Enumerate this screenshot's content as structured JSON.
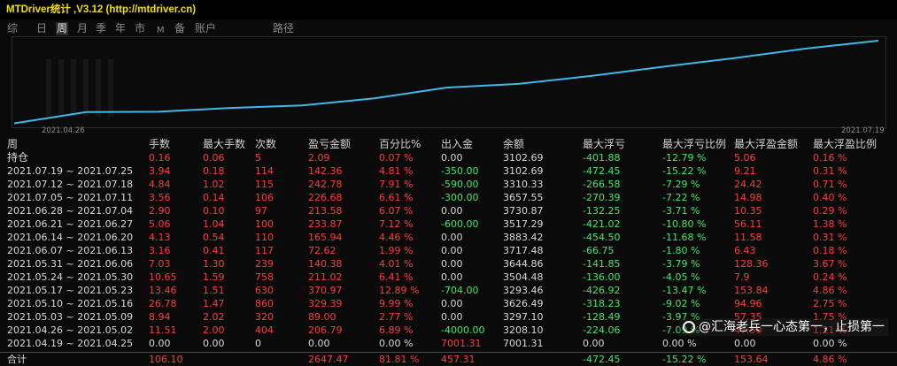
{
  "app": {
    "title": "MTDriver统计 ,V3.12 (http://mtdriver.cn)"
  },
  "tabs": [
    {
      "label": "综",
      "active": false
    },
    {
      "label": "日",
      "active": false
    },
    {
      "label": "周",
      "active": true
    },
    {
      "label": "月",
      "active": false
    },
    {
      "label": "季",
      "active": false
    },
    {
      "label": "年",
      "active": false
    },
    {
      "label": "市",
      "active": false
    },
    {
      "label": "M",
      "active": false
    },
    {
      "label": "备",
      "active": false
    },
    {
      "label": "账户",
      "active": false
    },
    {
      "label": "路径",
      "active": false
    }
  ],
  "chart_data": {
    "type": "line",
    "x": [
      "2021.04.26",
      "2021.05.03",
      "2021.05.10",
      "2021.05.17",
      "2021.05.24",
      "2021.05.31",
      "2021.06.07",
      "2021.06.14",
      "2021.06.21",
      "2021.06.28",
      "2021.07.05",
      "2021.07.12",
      "2021.07.19"
    ],
    "series": [
      {
        "values": [
          10,
          280,
          290,
          380,
          440,
          610,
          870,
          960,
          1150,
          1370,
          1580,
          1810,
          2000
        ]
      }
    ],
    "xlabel_start": "2021.04.26",
    "xlabel_end": "2021.07.19",
    "color": "#3fb8ea"
  },
  "table": {
    "headers": [
      "周",
      "手数",
      "最大手数",
      "次数",
      "盈亏金额",
      "百分比%",
      "出入金",
      "余额",
      "最大浮亏",
      "最大浮亏比例",
      "最大浮盈金额",
      "最大浮盈比例"
    ],
    "rows": [
      [
        "持仓",
        "0.16",
        "0.06",
        "5",
        "2.09",
        "0.07 %",
        "0.00",
        "3102.69",
        "-401.88",
        "-12.79 %",
        "5.06",
        "0.16 %"
      ],
      [
        "2021.07.19 ~ 2021.07.25",
        "3.94",
        "0.18",
        "114",
        "142.36",
        "4.81 %",
        "-350.00",
        "3102.69",
        "-472.45",
        "-15.22 %",
        "9.21",
        "0.31 %"
      ],
      [
        "2021.07.12 ~ 2021.07.18",
        "4.84",
        "1.02",
        "115",
        "242.78",
        "7.91 %",
        "-590.00",
        "3310.33",
        "-266.58",
        "-7.29 %",
        "24.42",
        "0.71 %"
      ],
      [
        "2021.07.05 ~ 2021.07.11",
        "3.56",
        "0.14",
        "106",
        "226.68",
        "6.61 %",
        "-300.00",
        "3657.55",
        "-270.39",
        "-7.22 %",
        "14.98",
        "0.40 %"
      ],
      [
        "2021.06.28 ~ 2021.07.04",
        "2.90",
        "0.10",
        "97",
        "213.58",
        "6.07 %",
        "0.00",
        "3730.87",
        "-132.25",
        "-3.71 %",
        "10.35",
        "0.29 %"
      ],
      [
        "2021.06.21 ~ 2021.06.27",
        "5.06",
        "1.04",
        "100",
        "233.87",
        "7.12 %",
        "-600.00",
        "3517.29",
        "-421.02",
        "-10.80 %",
        "56.11",
        "1.38 %"
      ],
      [
        "2021.06.14 ~ 2021.06.20",
        "4.13",
        "0.54",
        "110",
        "165.94",
        "4.46 %",
        "0.00",
        "3883.42",
        "-454.50",
        "-11.68 %",
        "11.58",
        "0.31 %"
      ],
      [
        "2021.06.07 ~ 2021.06.13",
        "3.16",
        "0.41",
        "117",
        "72.62",
        "1.99 %",
        "0.00",
        "3717.48",
        "-66.75",
        "-1.80 %",
        "6.43",
        "0.18 %"
      ],
      [
        "2021.05.31 ~ 2021.06.06",
        "7.03",
        "1.30",
        "239",
        "140.38",
        "4.01 %",
        "0.00",
        "3644.86",
        "-141.85",
        "-3.79 %",
        "128.36",
        "3.67 %"
      ],
      [
        "2021.05.24 ~ 2021.05.30",
        "10.65",
        "1.59",
        "758",
        "211.02",
        "6.41 %",
        "0.00",
        "3504.48",
        "-136.00",
        "-4.05 %",
        "7.9",
        "0.24 %"
      ],
      [
        "2021.05.17 ~ 2021.05.23",
        "13.46",
        "1.51",
        "630",
        "370.97",
        "12.89 %",
        "-704.00",
        "3293.46",
        "-426.92",
        "-13.47 %",
        "153.84",
        "4.86 %"
      ],
      [
        "2021.05.10 ~ 2021.05.16",
        "26.78",
        "1.47",
        "860",
        "329.39",
        "9.99 %",
        "0.00",
        "3626.49",
        "-318.23",
        "-9.02 %",
        "94.96",
        "2.75 %"
      ],
      [
        "2021.05.03 ~ 2021.05.09",
        "8.94",
        "2.02",
        "320",
        "89.00",
        "2.77 %",
        "0.00",
        "3297.10",
        "-128.49",
        "-3.97 %",
        "57.35",
        "1.75 %"
      ],
      [
        "2021.04.26 ~ 2021.05.02",
        "11.51",
        "2.00",
        "404",
        "206.79",
        "6.89 %",
        "-4000.00",
        "3208.10",
        "-224.06",
        "-7.09 %",
        "47.50",
        "1.21 %"
      ],
      [
        "2021.04.19 ~ 2021.04.25",
        "0.00",
        "0.00",
        "0",
        "0.00",
        "0.00 %",
        "7001.31",
        "7001.31",
        "0.00",
        "0.00 %",
        "0.00",
        "0.00 %"
      ]
    ],
    "total": [
      "合计",
      "106.10",
      "",
      "",
      "2647.47",
      "81.81 %",
      "457.31",
      "",
      "-472.45",
      "-15.22 %",
      "153.64",
      "4.86 %"
    ]
  },
  "watermark": {
    "text": "@汇海老兵一心态第一，止损第一"
  }
}
